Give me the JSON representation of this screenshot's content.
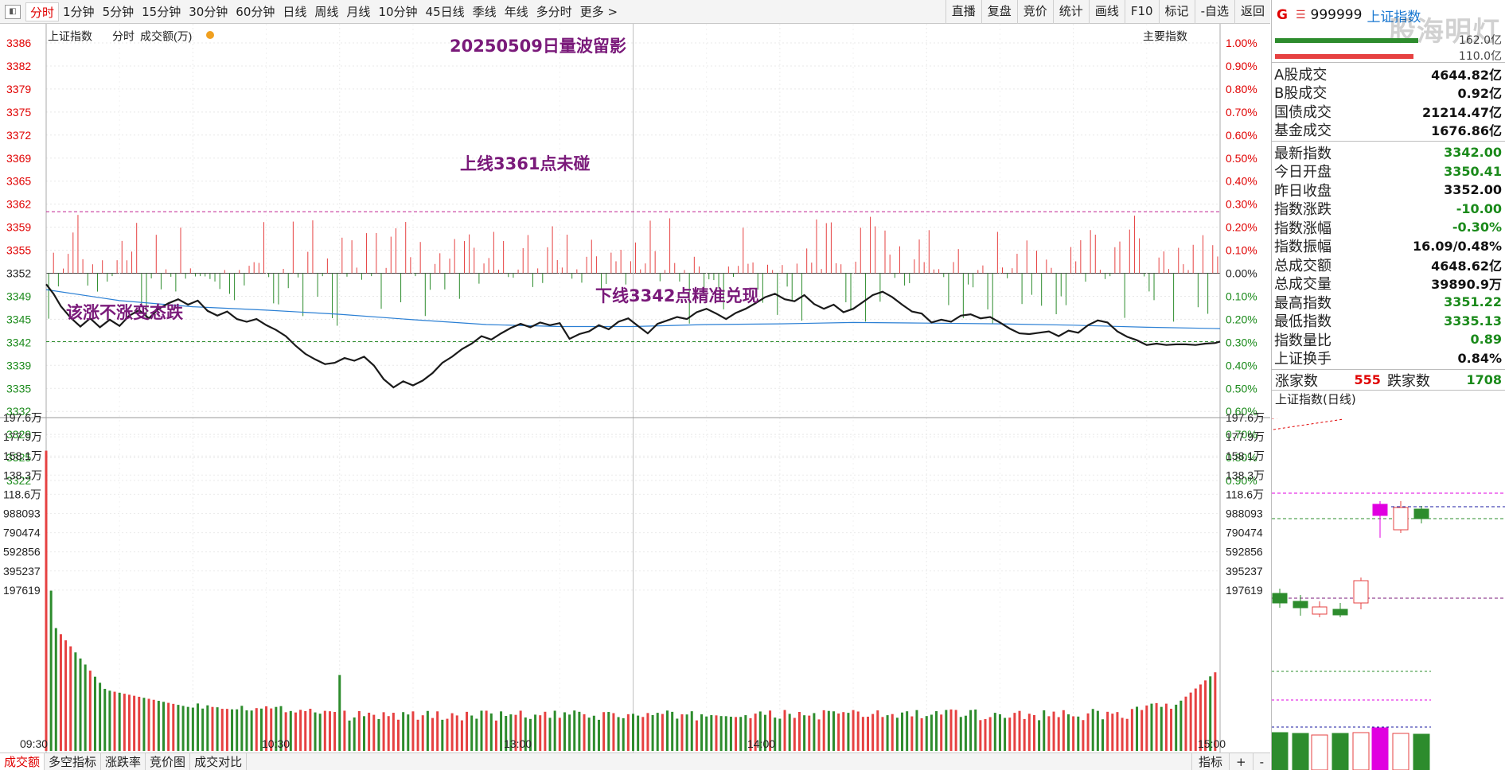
{
  "toolbar": {
    "period_tabs": [
      "分时",
      "1分钟",
      "5分钟",
      "15分钟",
      "30分钟",
      "60分钟",
      "日线",
      "周线",
      "月线",
      "10分钟",
      "45日线",
      "季线",
      "年线",
      "多分时",
      "更多 >"
    ],
    "active_tab": "分时",
    "right_tools": [
      "直播",
      "复盘",
      "竞价",
      "统计",
      "画线",
      "F10",
      "标记",
      "-自选",
      "返回"
    ]
  },
  "chart_header": {
    "index_name": "上证指数",
    "mode": "分时",
    "volume_unit": "成交额(万)",
    "main_index_label": "主要指数"
  },
  "annotations": {
    "title": "20250509日量波留影",
    "upper_line_note": "上线3361点未碰",
    "lower_line_note": "下线3342点精准兑现",
    "left_note": "该涨不涨变态跌"
  },
  "chart_data": {
    "type": "line",
    "prev_close": 3352,
    "price_axis_left": [
      "3386",
      "3382",
      "3379",
      "3375",
      "3372",
      "3369",
      "3365",
      "3362",
      "3359",
      "3355",
      "3352",
      "3349",
      "3345",
      "3342",
      "3339",
      "3335",
      "3332",
      "3329",
      "3325",
      "3322"
    ],
    "pct_axis_right": [
      "1.00%",
      "0.90%",
      "0.80%",
      "0.70%",
      "0.60%",
      "0.50%",
      "0.40%",
      "0.30%",
      "0.20%",
      "0.10%",
      "0.00%",
      "0.10%",
      "0.20%",
      "0.30%",
      "0.40%",
      "0.50%",
      "0.60%",
      "0.70%",
      "0.80%",
      "0.90%"
    ],
    "ylim": [
      3319,
      3386
    ],
    "time_labels": [
      "09:30",
      "10:30",
      "13:00",
      "14:00",
      "15:00"
    ],
    "upper_level": 3361,
    "lower_level": 3342,
    "price_series": [
      [
        0,
        3350.4
      ],
      [
        3,
        3349
      ],
      [
        6,
        3347.2
      ],
      [
        10,
        3345.5
      ],
      [
        14,
        3344.2
      ],
      [
        18,
        3345.4
      ],
      [
        22,
        3344.1
      ],
      [
        26,
        3345.2
      ],
      [
        30,
        3344.3
      ],
      [
        34,
        3345.8
      ],
      [
        38,
        3346.6
      ],
      [
        42,
        3345.4
      ],
      [
        46,
        3346.8
      ],
      [
        50,
        3347.6
      ],
      [
        54,
        3348.2
      ],
      [
        58,
        3347.4
      ],
      [
        62,
        3348
      ],
      [
        66,
        3346.5
      ],
      [
        70,
        3345.8
      ],
      [
        74,
        3346.4
      ],
      [
        78,
        3345.3
      ],
      [
        82,
        3344.9
      ],
      [
        86,
        3345.3
      ],
      [
        90,
        3344.4
      ],
      [
        94,
        3343.7
      ],
      [
        98,
        3342.8
      ],
      [
        102,
        3341.4
      ],
      [
        106,
        3340.2
      ],
      [
        110,
        3339.4
      ],
      [
        114,
        3338.7
      ],
      [
        118,
        3338.9
      ],
      [
        122,
        3339.6
      ],
      [
        126,
        3339.2
      ],
      [
        130,
        3339.8
      ],
      [
        134,
        3338.5
      ],
      [
        138,
        3336.5
      ],
      [
        142,
        3335.3
      ],
      [
        146,
        3336.2
      ],
      [
        150,
        3335.6
      ],
      [
        154,
        3336.3
      ],
      [
        158,
        3337.4
      ],
      [
        162,
        3338.9
      ],
      [
        166,
        3339.8
      ],
      [
        170,
        3340.9
      ],
      [
        174,
        3341.7
      ],
      [
        178,
        3342.8
      ],
      [
        182,
        3342.3
      ],
      [
        186,
        3343.2
      ],
      [
        190,
        3344
      ],
      [
        194,
        3344.6
      ],
      [
        198,
        3344.1
      ],
      [
        202,
        3344.8
      ],
      [
        206,
        3344.4
      ],
      [
        210,
        3344.7
      ],
      [
        214,
        3342.4
      ],
      [
        218,
        3343.1
      ],
      [
        222,
        3343.5
      ],
      [
        226,
        3344.4
      ],
      [
        230,
        3343.8
      ],
      [
        234,
        3344.9
      ],
      [
        238,
        3345.4
      ],
      [
        242,
        3344.3
      ],
      [
        246,
        3343.2
      ],
      [
        250,
        3344.6
      ],
      [
        254,
        3345.1
      ],
      [
        258,
        3345.6
      ],
      [
        262,
        3345.3
      ],
      [
        266,
        3346.3
      ],
      [
        270,
        3346.8
      ],
      [
        274,
        3346.1
      ],
      [
        278,
        3345.3
      ],
      [
        282,
        3346.2
      ],
      [
        286,
        3346.8
      ],
      [
        290,
        3347.6
      ],
      [
        294,
        3348.5
      ],
      [
        298,
        3349
      ],
      [
        302,
        3348.2
      ],
      [
        306,
        3347.9
      ],
      [
        310,
        3348.8
      ],
      [
        314,
        3347.5
      ],
      [
        318,
        3346.8
      ],
      [
        322,
        3347.4
      ],
      [
        326,
        3346.3
      ],
      [
        330,
        3346.8
      ],
      [
        334,
        3347.8
      ],
      [
        338,
        3348.8
      ],
      [
        342,
        3349.3
      ],
      [
        346,
        3348.5
      ],
      [
        350,
        3347.4
      ],
      [
        354,
        3346.4
      ],
      [
        358,
        3346.1
      ],
      [
        362,
        3344.8
      ],
      [
        366,
        3345.2
      ],
      [
        370,
        3344.9
      ],
      [
        374,
        3345.8
      ],
      [
        378,
        3346
      ],
      [
        382,
        3345.4
      ],
      [
        386,
        3345.6
      ],
      [
        390,
        3344.8
      ],
      [
        394,
        3343.9
      ],
      [
        398,
        3343.2
      ],
      [
        402,
        3343.1
      ],
      [
        406,
        3343.3
      ],
      [
        410,
        3343.5
      ],
      [
        414,
        3342.8
      ],
      [
        418,
        3343.6
      ],
      [
        422,
        3343.3
      ],
      [
        426,
        3344.4
      ],
      [
        430,
        3345.1
      ],
      [
        434,
        3344.8
      ],
      [
        438,
        3343.5
      ],
      [
        442,
        3342.7
      ],
      [
        446,
        3342.2
      ],
      [
        450,
        3341.5
      ],
      [
        454,
        3341.7
      ],
      [
        458,
        3341.5
      ],
      [
        462,
        3341.6
      ],
      [
        466,
        3341.6
      ],
      [
        470,
        3341.5
      ],
      [
        474,
        3341.7
      ],
      [
        478,
        3341.8
      ],
      [
        480,
        3342
      ]
    ],
    "avg_series": [
      [
        0,
        3349.6
      ],
      [
        30,
        3348
      ],
      [
        60,
        3347.1
      ],
      [
        90,
        3346.6
      ],
      [
        120,
        3346
      ],
      [
        150,
        3345.2
      ],
      [
        180,
        3344.5
      ],
      [
        210,
        3344.2
      ],
      [
        240,
        3344.2
      ],
      [
        270,
        3344.5
      ],
      [
        300,
        3344.6
      ],
      [
        330,
        3344.8
      ],
      [
        360,
        3344.7
      ],
      [
        390,
        3344.6
      ],
      [
        420,
        3344.4
      ],
      [
        450,
        3344.1
      ],
      [
        480,
        3343.9
      ]
    ],
    "volume_axis": [
      "197.6万",
      "177.9万",
      "158.1万",
      "138.3万",
      "118.6万",
      "988093",
      "790474",
      "592856",
      "395237",
      "197619"
    ],
    "volume_ylim": [
      0,
      1976000
    ]
  },
  "right_panel": {
    "header": {
      "g": "G",
      "menu": "☰",
      "code": "999999",
      "name": "上证指数"
    },
    "watermark": "股海明灯",
    "buysell_values": [
      "162.0亿",
      "110.0亿"
    ],
    "turnover": [
      {
        "label": "A股成交",
        "value": "4644.82亿",
        "color": "black"
      },
      {
        "label": "B股成交",
        "value": "0.92亿",
        "color": "black"
      },
      {
        "label": "国债成交",
        "value": "21214.47亿",
        "color": "black"
      },
      {
        "label": "基金成交",
        "value": "1676.86亿",
        "color": "black"
      }
    ],
    "quotes": [
      {
        "label": "最新指数",
        "value": "3342.00",
        "color": "green"
      },
      {
        "label": "今日开盘",
        "value": "3350.41",
        "color": "green"
      },
      {
        "label": "昨日收盘",
        "value": "3352.00",
        "color": "black"
      },
      {
        "label": "指数涨跌",
        "value": "-10.00",
        "color": "green"
      },
      {
        "label": "指数涨幅",
        "value": "-0.30%",
        "color": "green"
      },
      {
        "label": "指数振幅",
        "value": "16.09/0.48%",
        "color": "black"
      },
      {
        "label": "总成交额",
        "value": "4648.62亿",
        "color": "black"
      },
      {
        "label": "总成交量",
        "value": "39890.9万",
        "color": "black"
      },
      {
        "label": "最高指数",
        "value": "3351.22",
        "color": "green"
      },
      {
        "label": "最低指数",
        "value": "3335.13",
        "color": "green"
      },
      {
        "label": "指数量比",
        "value": "0.89",
        "color": "green"
      },
      {
        "label": "上证换手",
        "value": "0.84%",
        "color": "black"
      }
    ],
    "advance_label": "涨家数",
    "advance_count": "555",
    "decline_label": "跌家数",
    "decline_count": "1708",
    "mini_chart_title": "上证指数(日线)"
  },
  "bottom_tabs": [
    "成交额",
    "多空指标",
    "涨跌率",
    "竞价图",
    "成交对比"
  ],
  "bottom_active": "成交额",
  "bottom_right": [
    "指标",
    "+",
    "-"
  ],
  "colors": {
    "up": "#e64141",
    "down": "#2d8c2d",
    "price_line": "#1a1a1a",
    "avg_line": "#2a7fd4",
    "annotation": "#7a1a7a"
  }
}
